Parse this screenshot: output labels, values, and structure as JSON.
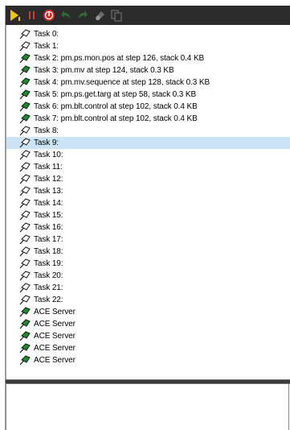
{
  "toolbar": {
    "buttons": [
      {
        "icon": "run-step-icon",
        "color": "#f5c400",
        "enabled": true
      },
      {
        "icon": "pause-icon",
        "color": "#d43a2a",
        "enabled": true
      },
      {
        "icon": "abort-icon",
        "color": "#d42a2a",
        "enabled": true
      },
      {
        "icon": "undo-icon",
        "color": "#2f6a35",
        "enabled": false
      },
      {
        "icon": "redo-icon",
        "color": "#2f6a35",
        "enabled": false
      },
      {
        "icon": "eraser-icon",
        "color": "#6e6e6e",
        "enabled": false
      },
      {
        "icon": "copy-icon",
        "color": "#6e6e6e",
        "enabled": false
      }
    ]
  },
  "tasks": [
    {
      "label": "Task 0:",
      "state": "idle"
    },
    {
      "label": "Task 1:",
      "state": "idle"
    },
    {
      "label": "Task 2: pm.ps.mon.pos at step 126, stack 0.4 KB",
      "state": "running"
    },
    {
      "label": "Task 3: pm.mv at step 124, stack 0.3 KB",
      "state": "running"
    },
    {
      "label": "Task 4: pm.mv.sequence at step 128, stack 0.3 KB",
      "state": "running"
    },
    {
      "label": "Task 5: pm.ps.get.targ at step 58, stack 0.3 KB",
      "state": "running"
    },
    {
      "label": "Task 6: pm.blt.control at step 102, stack 0.4 KB",
      "state": "running"
    },
    {
      "label": "Task 7: pm.blt.control at step 102, stack 0.4 KB",
      "state": "running"
    },
    {
      "label": "Task 8:",
      "state": "idle"
    },
    {
      "label": "Task 9:",
      "state": "idle",
      "selected": true
    },
    {
      "label": "Task 10:",
      "state": "idle"
    },
    {
      "label": "Task 11:",
      "state": "idle"
    },
    {
      "label": "Task 12:",
      "state": "idle"
    },
    {
      "label": "Task 13:",
      "state": "idle"
    },
    {
      "label": "Task 14:",
      "state": "idle"
    },
    {
      "label": "Task 15:",
      "state": "idle"
    },
    {
      "label": "Task 16:",
      "state": "idle"
    },
    {
      "label": "Task 17:",
      "state": "idle"
    },
    {
      "label": "Task 18:",
      "state": "idle"
    },
    {
      "label": "Task 19:",
      "state": "idle"
    },
    {
      "label": "Task 20:",
      "state": "idle"
    },
    {
      "label": "Task 21:",
      "state": "idle"
    },
    {
      "label": "Task 22:",
      "state": "idle"
    },
    {
      "label": "ACE Server",
      "state": "running"
    },
    {
      "label": "ACE Server",
      "state": "running"
    },
    {
      "label": "ACE Server",
      "state": "running"
    },
    {
      "label": "ACE Server",
      "state": "running"
    },
    {
      "label": "ACE Server",
      "state": "running"
    }
  ],
  "colors": {
    "toolbar_bg": "#2b2b2b",
    "selection": "#cce4f7",
    "running_flag": "#1e8a2e",
    "idle_flag": "#ffffff"
  }
}
